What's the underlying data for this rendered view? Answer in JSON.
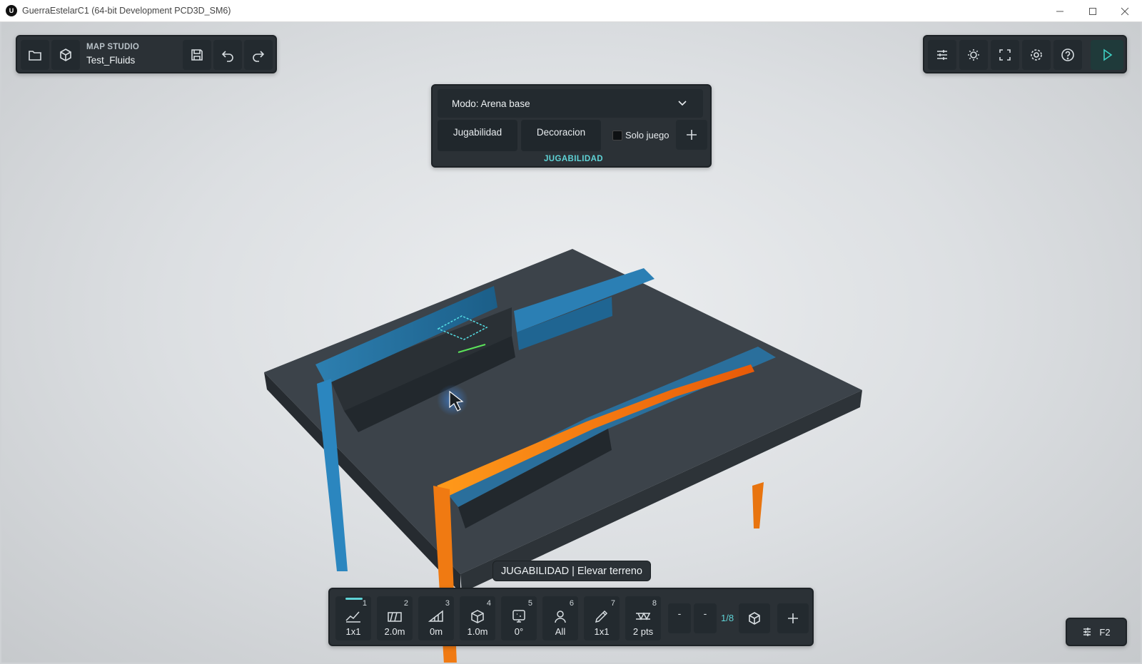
{
  "window": {
    "title": "GuerraEstelarC1 (64-bit Development PCD3D_SM6)",
    "controls": [
      "minimize-icon",
      "maximize-icon",
      "close-icon"
    ]
  },
  "top_left": {
    "studio_label": "MAP STUDIO",
    "map_name": "Test_Fluids",
    "icons": [
      "folder-icon",
      "cube-icon",
      "save-icon",
      "undo-icon",
      "redo-icon"
    ]
  },
  "top_right": {
    "icons": [
      "sliders-icon",
      "sun-icon",
      "fullscreen-icon",
      "settings-icon",
      "help-icon",
      "play-icon"
    ],
    "play_color": "#3ecfc3"
  },
  "mode_panel": {
    "select_value": "Modo: Arena base",
    "tabs": [
      "Jugabilidad",
      "Decoracion"
    ],
    "checkbox_label": "Solo juego",
    "checkbox_checked": false,
    "add_label": "+",
    "section": "JUGABILIDAD",
    "accent": "#5fd3d6"
  },
  "tooltip": "JUGABILIDAD | Elevar terreno",
  "toolbar": {
    "tools": [
      {
        "num": "1",
        "value": "1x1",
        "icon": "terrain-raise-icon",
        "active": true
      },
      {
        "num": "2",
        "value": "2.0m",
        "icon": "brush-size-icon"
      },
      {
        "num": "3",
        "value": "0m",
        "icon": "slope-icon"
      },
      {
        "num": "4",
        "value": "1.0m",
        "icon": "box-height-icon"
      },
      {
        "num": "5",
        "value": "0°",
        "icon": "rotation-icon"
      },
      {
        "num": "6",
        "value": "All",
        "icon": "player-icon"
      },
      {
        "num": "7",
        "value": "1x1",
        "icon": "pencil-icon"
      },
      {
        "num": "8",
        "value": "2 pts",
        "icon": "points-icon"
      }
    ],
    "prev_label": "-",
    "next_label": "-",
    "page": "1/8",
    "icons": [
      "cube-icon",
      "plus-icon"
    ]
  },
  "f2_button": {
    "label": "F2",
    "icon": "sliders-icon"
  }
}
